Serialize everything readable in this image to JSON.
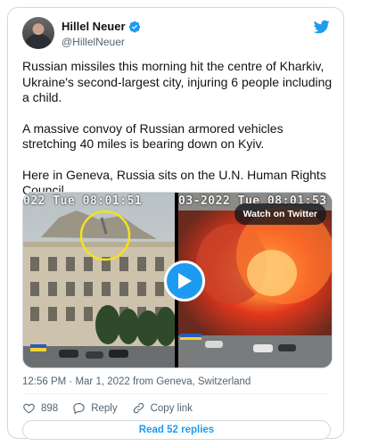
{
  "author": {
    "display_name": "Hillel Neuer",
    "handle": "@HillelNeuer"
  },
  "tweet": {
    "paragraphs": [
      "Russian missiles this morning hit the centre of Kharkiv, Ukraine's second-largest city, injuring 6 people including a child.",
      "A massive convoy of Russian armored vehicles stretching 40 miles is bearing down on Kyiv.",
      "Here in Geneva, Russia sits on the U.N. Human Rights Council."
    ]
  },
  "media": {
    "left_overlay": "022 Tue 08:01:51",
    "right_overlay": "03-2022 Tue 08:01:53",
    "watch_label": "Watch on Twitter"
  },
  "meta": {
    "timestamp": "12:56 PM · Mar 1, 2022 from Geneva, Switzerland"
  },
  "actions": {
    "like_count": "898",
    "reply_label": "Reply",
    "copy_link_label": "Copy link"
  },
  "read_replies_label": "Read 52 replies",
  "colors": {
    "accent": "#1d9bf0",
    "text": "#0f1419",
    "secondary": "#536471",
    "border": "#cfd9de"
  },
  "icons": [
    "verified-badge-icon",
    "twitter-bird-icon",
    "play-icon",
    "heart-icon",
    "reply-bubble-icon",
    "link-icon"
  ]
}
